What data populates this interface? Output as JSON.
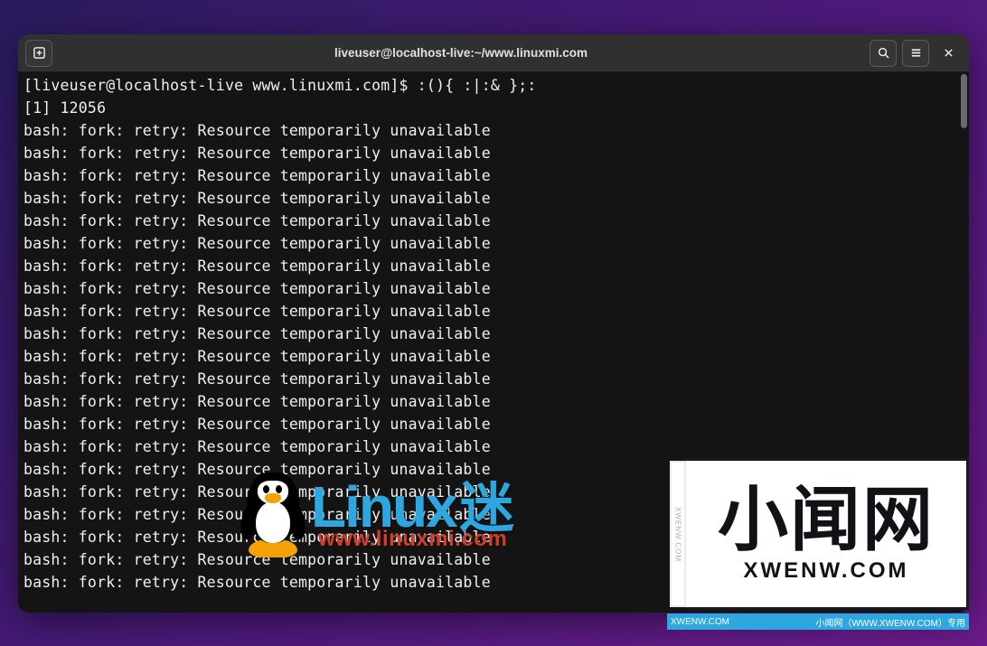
{
  "window": {
    "title": "liveuser@localhost-live:~/www.linuxmi.com"
  },
  "terminal": {
    "prompt": "[liveuser@localhost-live www.linuxmi.com]$ ",
    "command": ":(){ :|:& };:",
    "job_line": "[1] 12056",
    "error_line": "bash: fork: retry: Resource temporarily unavailable",
    "error_repeat": 21
  },
  "overlay1": {
    "brand_latin": "Linux",
    "brand_cn": "迷",
    "url": "www.linuxmi.com"
  },
  "overlay2": {
    "cn": "小闻网",
    "en": "XWENW.COM",
    "side": "XWENW.COM"
  },
  "footer": {
    "left": "XWENW.COM",
    "right": "小闻网（WWW.XWENW.COM）专用"
  }
}
